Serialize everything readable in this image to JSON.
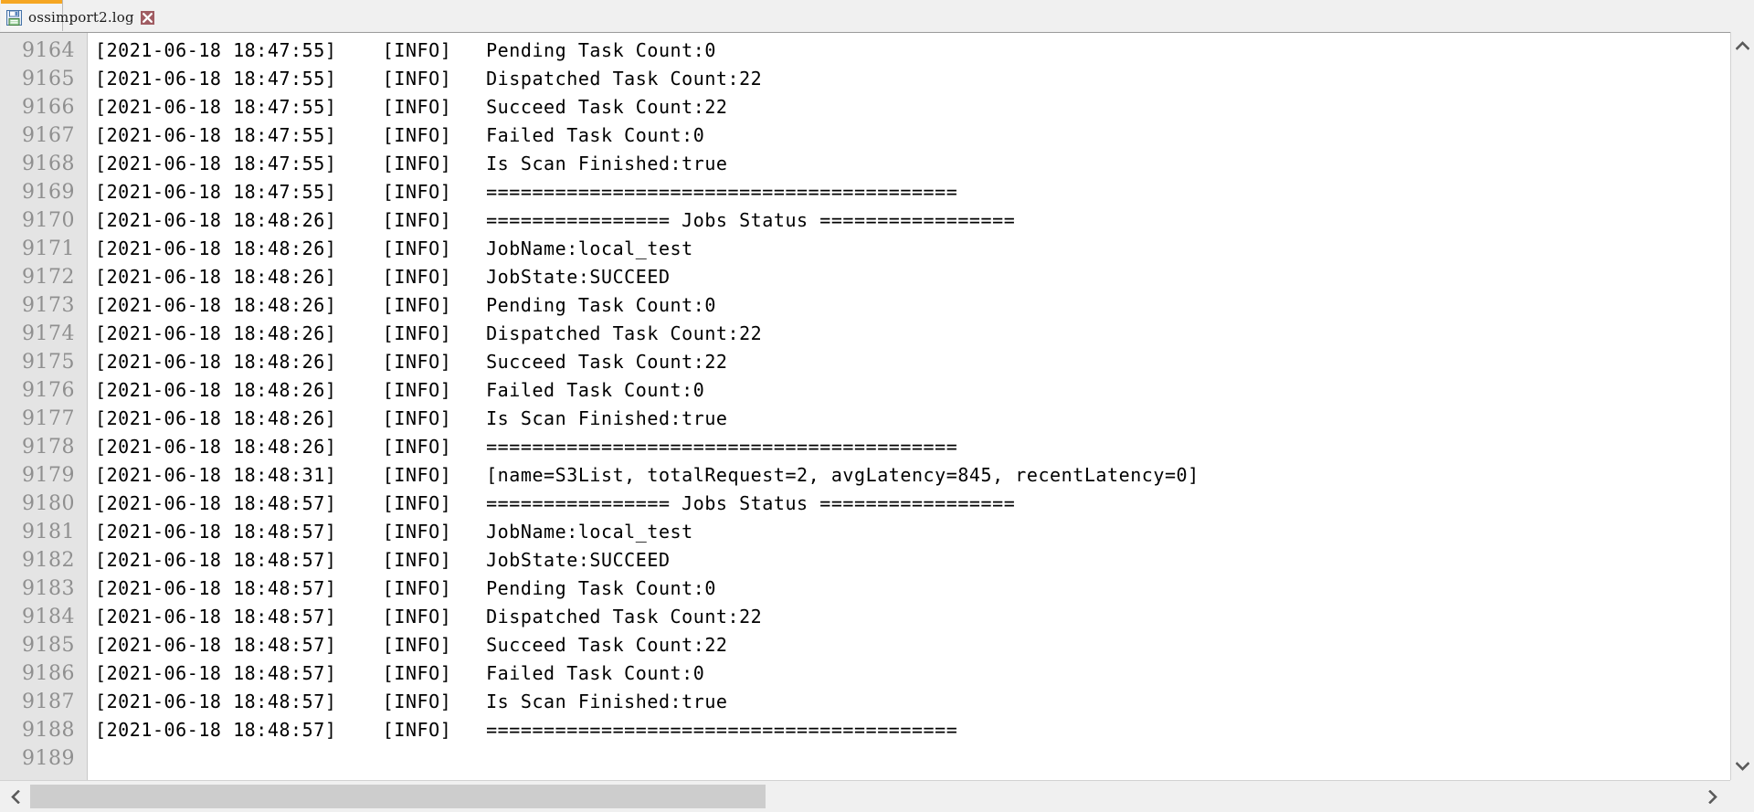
{
  "window": {
    "title": "ossimport2.log"
  },
  "tab": {
    "label": "ossimport2.log",
    "save_icon": "floppy-disk-icon",
    "close_icon": "close-icon",
    "accent_color": "#f5a623",
    "active": true
  },
  "editor": {
    "gutter_bg": "#e4e4e4",
    "line_number_color": "#8f8f8f",
    "text_color": "#000000",
    "background": "#ffffff",
    "first_visible_line": 9164,
    "last_visible_line": 9189,
    "lines": [
      {
        "no": "9164",
        "text": "[2021-06-18 18:47:55]    [INFO]   Pending Task Count:0"
      },
      {
        "no": "9165",
        "text": "[2021-06-18 18:47:55]    [INFO]   Dispatched Task Count:22"
      },
      {
        "no": "9166",
        "text": "[2021-06-18 18:47:55]    [INFO]   Succeed Task Count:22"
      },
      {
        "no": "9167",
        "text": "[2021-06-18 18:47:55]    [INFO]   Failed Task Count:0"
      },
      {
        "no": "9168",
        "text": "[2021-06-18 18:47:55]    [INFO]   Is Scan Finished:true"
      },
      {
        "no": "9169",
        "text": "[2021-06-18 18:47:55]    [INFO]   ========================================="
      },
      {
        "no": "9170",
        "text": "[2021-06-18 18:48:26]    [INFO]   ================ Jobs Status ================="
      },
      {
        "no": "9171",
        "text": "[2021-06-18 18:48:26]    [INFO]   JobName:local_test"
      },
      {
        "no": "9172",
        "text": "[2021-06-18 18:48:26]    [INFO]   JobState:SUCCEED"
      },
      {
        "no": "9173",
        "text": "[2021-06-18 18:48:26]    [INFO]   Pending Task Count:0"
      },
      {
        "no": "9174",
        "text": "[2021-06-18 18:48:26]    [INFO]   Dispatched Task Count:22"
      },
      {
        "no": "9175",
        "text": "[2021-06-18 18:48:26]    [INFO]   Succeed Task Count:22"
      },
      {
        "no": "9176",
        "text": "[2021-06-18 18:48:26]    [INFO]   Failed Task Count:0"
      },
      {
        "no": "9177",
        "text": "[2021-06-18 18:48:26]    [INFO]   Is Scan Finished:true"
      },
      {
        "no": "9178",
        "text": "[2021-06-18 18:48:26]    [INFO]   ========================================="
      },
      {
        "no": "9179",
        "text": "[2021-06-18 18:48:31]    [INFO]   [name=S3List, totalRequest=2, avgLatency=845, recentLatency=0]"
      },
      {
        "no": "9180",
        "text": "[2021-06-18 18:48:57]    [INFO]   ================ Jobs Status ================="
      },
      {
        "no": "9181",
        "text": "[2021-06-18 18:48:57]    [INFO]   JobName:local_test"
      },
      {
        "no": "9182",
        "text": "[2021-06-18 18:48:57]    [INFO]   JobState:SUCCEED"
      },
      {
        "no": "9183",
        "text": "[2021-06-18 18:48:57]    [INFO]   Pending Task Count:0"
      },
      {
        "no": "9184",
        "text": "[2021-06-18 18:48:57]    [INFO]   Dispatched Task Count:22"
      },
      {
        "no": "9185",
        "text": "[2021-06-18 18:48:57]    [INFO]   Succeed Task Count:22"
      },
      {
        "no": "9186",
        "text": "[2021-06-18 18:48:57]    [INFO]   Failed Task Count:0"
      },
      {
        "no": "9187",
        "text": "[2021-06-18 18:48:57]    [INFO]   Is Scan Finished:true"
      },
      {
        "no": "9188",
        "text": "[2021-06-18 18:48:57]    [INFO]   ========================================="
      },
      {
        "no": "9189",
        "text": ""
      }
    ]
  },
  "scrollbars": {
    "vertical": {
      "up_arrow_icon": "chevron-up-icon",
      "down_arrow_icon": "chevron-down-icon",
      "thumb_visible": false
    },
    "horizontal": {
      "left_arrow_icon": "chevron-left-icon",
      "right_arrow_icon": "chevron-right-icon",
      "thumb_color": "#cdcdcd",
      "thumb_visible": true
    }
  }
}
